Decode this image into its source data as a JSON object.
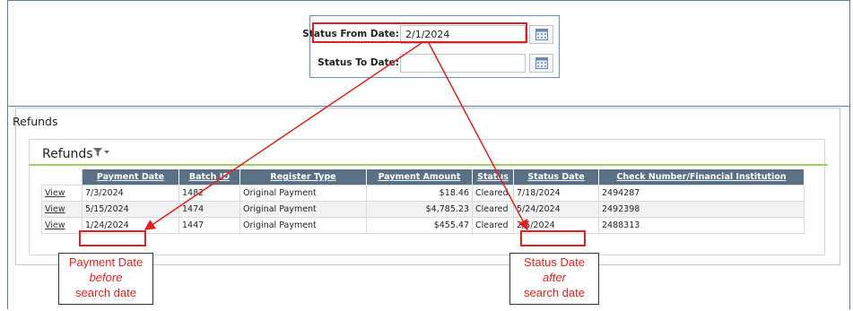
{
  "filters": {
    "status_from": {
      "label": "Status From Date:",
      "value": "2/1/2024"
    },
    "status_to": {
      "label": "Status To Date:",
      "value": ""
    }
  },
  "section": {
    "title": "Refunds"
  },
  "grid": {
    "title": "Refunds",
    "columns": [
      "",
      "Payment Date",
      "Batch ID",
      "Register Type",
      "Payment Amount",
      "Status",
      "Status Date",
      "Check Number/Financial Institution"
    ],
    "rows": [
      {
        "action": "View",
        "payment_date": "7/3/2024",
        "batch_id": "1482",
        "register_type": "Original Payment",
        "payment_amount": "$18.46",
        "status": "Cleared",
        "status_date": "7/18/2024",
        "check": "2494287"
      },
      {
        "action": "View",
        "payment_date": "5/15/2024",
        "batch_id": "1474",
        "register_type": "Original Payment",
        "payment_amount": "$4,785.23",
        "status": "Cleared",
        "status_date": "5/24/2024",
        "check": "2492398"
      },
      {
        "action": "View",
        "payment_date": "1/24/2024",
        "batch_id": "1447",
        "register_type": "Original Payment",
        "payment_amount": "$455.47",
        "status": "Cleared",
        "status_date": "2/5/2024",
        "check": "2488313"
      }
    ]
  },
  "annotations": {
    "left": {
      "line1": "Payment Date",
      "line2": "before",
      "line3": "search date"
    },
    "right": {
      "line1": "Status Date",
      "line2": "after",
      "line3": "search date"
    }
  },
  "colors": {
    "annotation": "#e02020",
    "header_bg": "#5a7185",
    "filter_underline": "#9bd35a"
  }
}
